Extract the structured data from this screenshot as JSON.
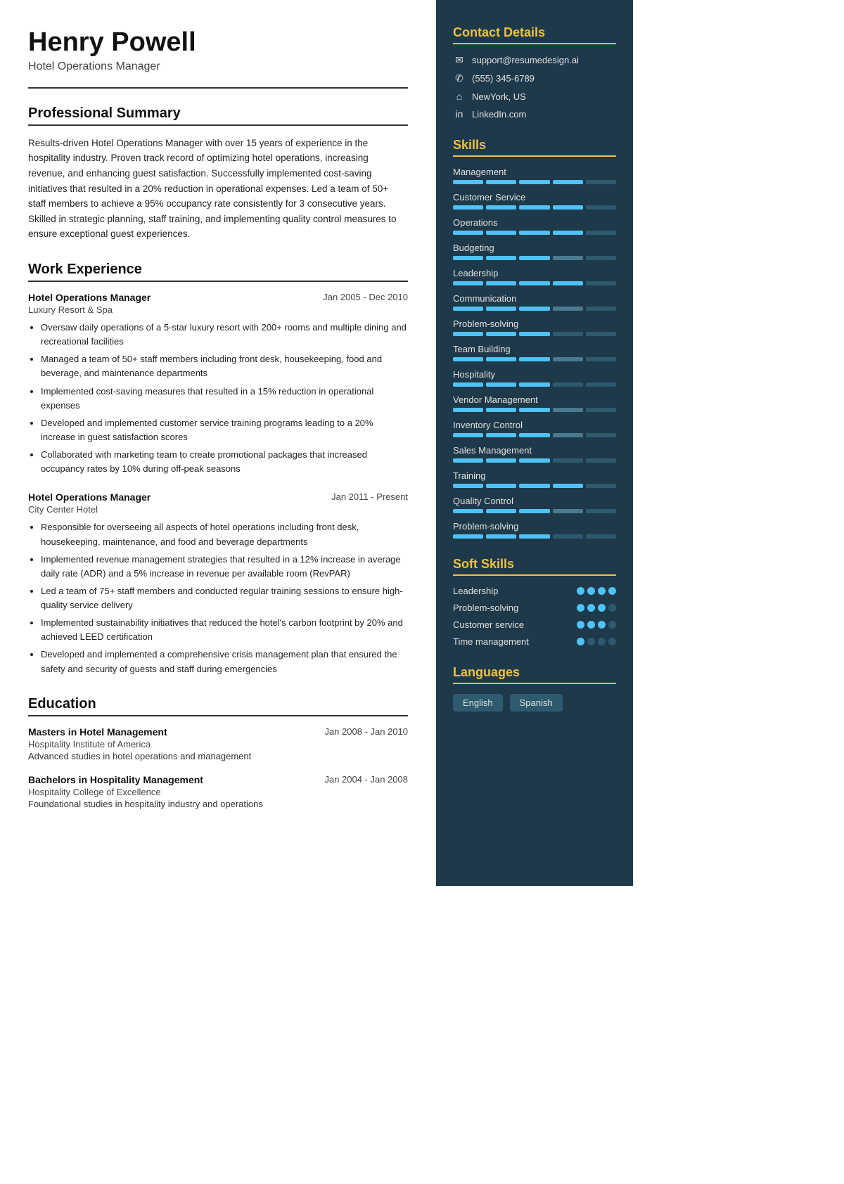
{
  "header": {
    "name": "Henry Powell",
    "job_title": "Hotel Operations Manager"
  },
  "summary": {
    "section_title": "Professional Summary",
    "text": "Results-driven Hotel Operations Manager with over 15 years of experience in the hospitality industry. Proven track record of optimizing hotel operations, increasing revenue, and enhancing guest satisfaction. Successfully implemented cost-saving initiatives that resulted in a 20% reduction in operational expenses. Led a team of 50+ staff members to achieve a 95% occupancy rate consistently for 3 consecutive years. Skilled in strategic planning, staff training, and implementing quality control measures to ensure exceptional guest experiences."
  },
  "work_experience": {
    "section_title": "Work Experience",
    "jobs": [
      {
        "title": "Hotel Operations Manager",
        "company": "Luxury Resort & Spa",
        "dates": "Jan 2005 - Dec 2010",
        "bullets": [
          "Oversaw daily operations of a 5-star luxury resort with 200+ rooms and multiple dining and recreational facilities",
          "Managed a team of 50+ staff members including front desk, housekeeping, food and beverage, and maintenance departments",
          "Implemented cost-saving measures that resulted in a 15% reduction in operational expenses",
          "Developed and implemented customer service training programs leading to a 20% increase in guest satisfaction scores",
          "Collaborated with marketing team to create promotional packages that increased occupancy rates by 10% during off-peak seasons"
        ]
      },
      {
        "title": "Hotel Operations Manager",
        "company": "City Center Hotel",
        "dates": "Jan 2011 - Present",
        "bullets": [
          "Responsible for overseeing all aspects of hotel operations including front desk, housekeeping, maintenance, and food and beverage departments",
          "Implemented revenue management strategies that resulted in a 12% increase in average daily rate (ADR) and a 5% increase in revenue per available room (RevPAR)",
          "Led a team of 75+ staff members and conducted regular training sessions to ensure high-quality service delivery",
          "Implemented sustainability initiatives that reduced the hotel's carbon footprint by 20% and achieved LEED certification",
          "Developed and implemented a comprehensive crisis management plan that ensured the safety and security of guests and staff during emergencies"
        ]
      }
    ]
  },
  "education": {
    "section_title": "Education",
    "items": [
      {
        "degree": "Masters in Hotel Management",
        "school": "Hospitality Institute of America",
        "dates": "Jan 2008 - Jan 2010",
        "desc": "Advanced studies in hotel operations and management"
      },
      {
        "degree": "Bachelors in Hospitality Management",
        "school": "Hospitality College of Excellence",
        "dates": "Jan 2004 - Jan 2008",
        "desc": "Foundational studies in hospitality industry and operations"
      }
    ]
  },
  "contact": {
    "section_title": "Contact Details",
    "email": "support@resumedesign.ai",
    "phone": "(555) 345-6789",
    "location": "NewYork, US",
    "linkedin": "LinkedIn.com"
  },
  "skills": {
    "section_title": "Skills",
    "items": [
      {
        "name": "Management",
        "filled": 4,
        "half": 0,
        "total": 5
      },
      {
        "name": "Customer Service",
        "filled": 4,
        "half": 0,
        "total": 5
      },
      {
        "name": "Operations",
        "filled": 4,
        "half": 0,
        "total": 5
      },
      {
        "name": "Budgeting",
        "filled": 3,
        "half": 1,
        "total": 5
      },
      {
        "name": "Leadership",
        "filled": 4,
        "half": 0,
        "total": 5
      },
      {
        "name": "Communication",
        "filled": 3,
        "half": 1,
        "total": 5
      },
      {
        "name": "Problem-solving",
        "filled": 3,
        "half": 0,
        "total": 5
      },
      {
        "name": "Team Building",
        "filled": 3,
        "half": 1,
        "total": 5
      },
      {
        "name": "Hospitality",
        "filled": 3,
        "half": 0,
        "total": 5
      },
      {
        "name": "Vendor Management",
        "filled": 3,
        "half": 1,
        "total": 5
      },
      {
        "name": "Inventory Control",
        "filled": 3,
        "half": 1,
        "total": 5
      },
      {
        "name": "Sales Management",
        "filled": 3,
        "half": 0,
        "total": 5
      },
      {
        "name": "Training",
        "filled": 4,
        "half": 0,
        "total": 5
      },
      {
        "name": "Quality Control",
        "filled": 3,
        "half": 1,
        "total": 5
      },
      {
        "name": "Problem-solving",
        "filled": 3,
        "half": 0,
        "total": 5
      }
    ]
  },
  "soft_skills": {
    "section_title": "Soft Skills",
    "items": [
      {
        "name": "Leadership",
        "filled": 4,
        "total": 4
      },
      {
        "name": "Problem-solving",
        "filled": 3,
        "total": 4
      },
      {
        "name": "Customer service",
        "filled": 3,
        "total": 4
      },
      {
        "name": "Time management",
        "filled": 1,
        "total": 4
      }
    ]
  },
  "languages": {
    "section_title": "Languages",
    "items": [
      "English",
      "Spanish"
    ]
  }
}
